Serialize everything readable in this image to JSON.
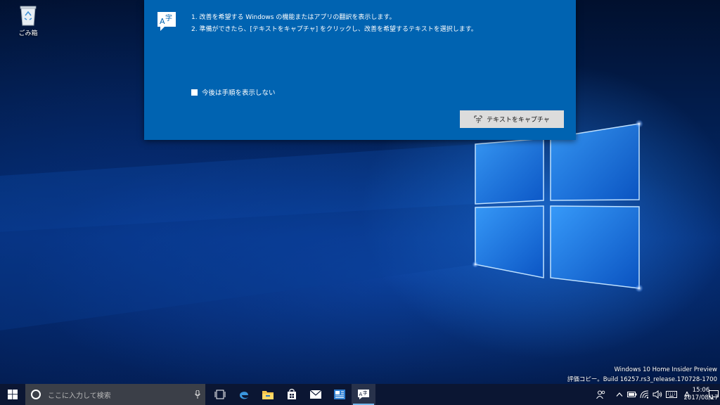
{
  "desktop": {
    "recycle_bin_label": "ごみ箱"
  },
  "translator": {
    "steps": [
      "1. 改善を希望する Windows の機能またはアプリの翻訳を表示します。",
      "2. 準備ができたら、[テキストをキャプチャ] をクリックし、改善を希望するテキストを選択します。"
    ],
    "checkbox_label": "今後は手順を表示しない",
    "capture_button_label": "テキストをキャプチャ"
  },
  "watermark": {
    "line1": "Windows 10 Home Insider Preview",
    "line2": "評価コピー。Build 16257.rs3_release.170728-1700"
  },
  "taskbar": {
    "search_placeholder": "ここに入力して検索",
    "ime_indicator": "A",
    "time": "15:06",
    "date": "2017/08/17",
    "pinned": [
      "task-view-icon",
      "edge-icon",
      "file-explorer-icon",
      "store-icon",
      "mail-icon",
      "news-icon",
      "translator-icon"
    ]
  },
  "colors": {
    "panel": "#0063b1",
    "taskbar": "#0b1633",
    "accent": "#76b9ed"
  }
}
